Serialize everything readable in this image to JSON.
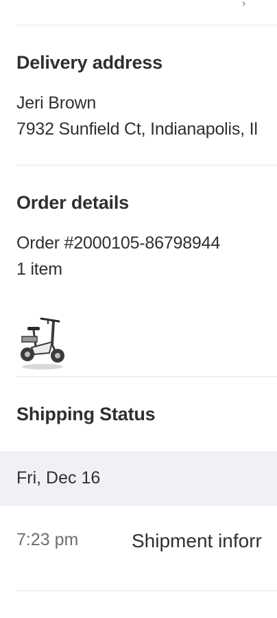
{
  "delivery": {
    "title": "Delivery address",
    "name": "Jeri Brown",
    "address": "7932 Sunfield Ct, Indianapolis, Il"
  },
  "order": {
    "title": "Order details",
    "number": "Order #2000105-86798944",
    "item_count": "1 item",
    "item_thumbnail": "electric-bike-image"
  },
  "shipping": {
    "title": "Shipping Status",
    "date": "Fri, Dec 16",
    "events": [
      {
        "time": "7:23 pm",
        "description": "Shipment inforr"
      }
    ]
  }
}
